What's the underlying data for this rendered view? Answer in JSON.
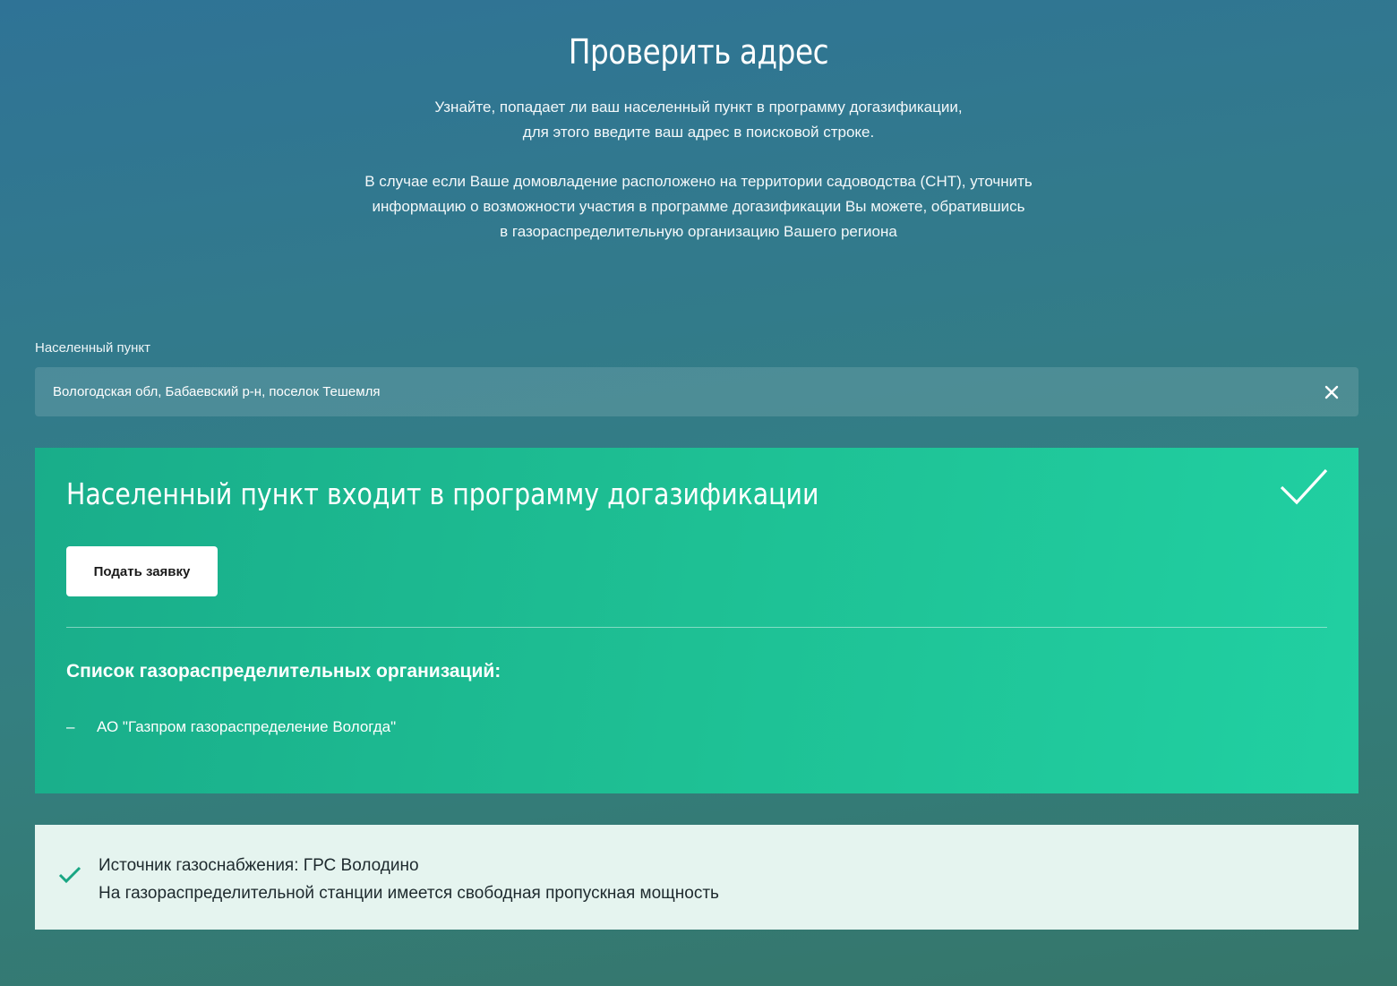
{
  "header": {
    "title": "Проверить адрес",
    "intro_line1": "Узнайте, попадает ли ваш населенный пункт в программу догазификации,",
    "intro_line2": "для этого введите ваш адрес в поисковой строке.",
    "note_line1": "В случае если Ваше домовладение расположено на территории садоводства (СНТ), уточнить",
    "note_line2": "информацию о возможности участия в программе догазификации Вы можете, обратившись",
    "note_line3": "в газораспределительную организацию Вашего региона"
  },
  "search": {
    "label": "Населенный пункт",
    "value": "Вологодская обл, Бабаевский р-н, поселок Тешемля",
    "clear_icon": "close-icon"
  },
  "result": {
    "title": "Населенный пункт входит в программу догазификации",
    "status_icon": "checkmark-icon",
    "apply_label": "Подать заявку",
    "orgs_heading": "Список газораспределительных организаций:",
    "orgs": [
      {
        "dash": "–",
        "name": "АО \"Газпром газораспределение Вологда\""
      }
    ],
    "color": "#1ec094"
  },
  "source": {
    "icon": "checkmark-icon",
    "line1": "Источник газоснабжения: ГРС Володино",
    "line2": "На газораспределительной станции имеется свободная пропускная мощность",
    "color": "#e5f4ef"
  }
}
